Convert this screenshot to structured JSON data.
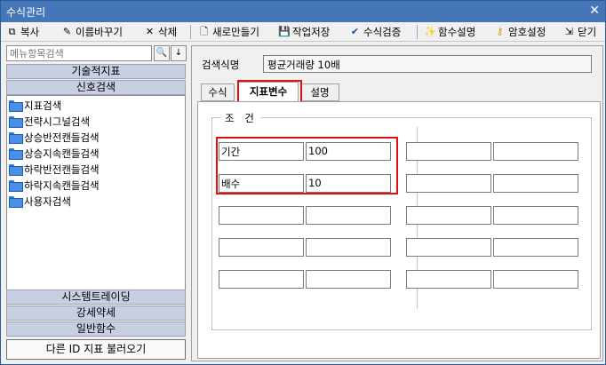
{
  "window": {
    "title": "수식관리",
    "close_glyph": "✕"
  },
  "toolbar": {
    "copy": "복사",
    "rename": "이름바꾸기",
    "delete": "삭제",
    "new": "새로만들기",
    "save": "작업저장",
    "verify": "수식검증",
    "func_help": "함수설명",
    "password": "암호설정",
    "close": "닫기"
  },
  "sidebar": {
    "search_placeholder": "메뉴항목검색",
    "categories": [
      "기술적지표",
      "신호검색",
      "시스템트레이딩",
      "강세약세",
      "일반함수"
    ],
    "tree_items": [
      "지표검색",
      "전략시그널검색",
      "상승반전캔들검색",
      "상승지속캔들검색",
      "하락반전캔들검색",
      "하락지속캔들검색",
      "사용자검색"
    ],
    "load_button": "다른 ID 지표 불러오기"
  },
  "main": {
    "name_label": "검색식명",
    "name_value": "평균거래량 10배",
    "tabs": [
      "수식",
      "지표변수",
      "설명"
    ],
    "active_tab": "지표변수",
    "group_label": "조 건",
    "params": [
      {
        "name": "기간",
        "value": "100"
      },
      {
        "name": "배수",
        "value": "10"
      }
    ]
  },
  "colors": {
    "titlebar": "#4577b8",
    "highlight": "#e01010",
    "category": "#c7cfe0"
  }
}
